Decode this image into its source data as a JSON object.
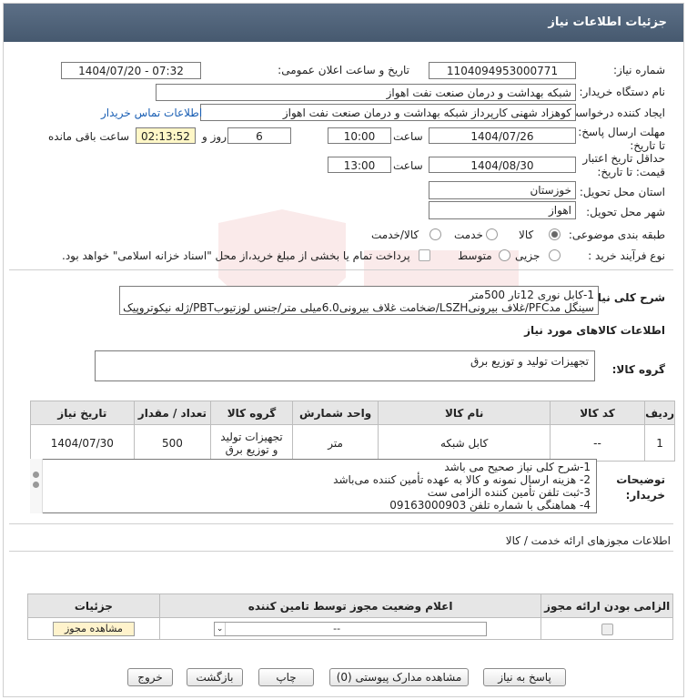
{
  "header": {
    "title": "جزئیات اطلاعات نیاز"
  },
  "form": {
    "need_number_label": "شماره نیاز:",
    "need_number": "1104094953000771",
    "announce_label": "تاریخ و ساعت اعلان عمومی:",
    "announce_value": "1404/07/20 - 07:32",
    "buyer_org_label": "نام دستگاه خریدار:",
    "buyer_org": "شبکه بهداشت و درمان صنعت نفت اهواز",
    "requester_label": "ایجاد کننده درخواست:",
    "requester": "کوهزاد شهنی کارپرداز شبکه بهداشت و درمان صنعت نفت اهواز",
    "contact_link": "اطلاعات تماس خریدار",
    "deadline_label": "مهلت ارسال پاسخ: تا تاریخ:",
    "deadline_date": "1404/07/26",
    "time_label": "ساعت",
    "deadline_time": "10:00",
    "days_value": "6",
    "days_label": "روز و",
    "remaining_value": "02:13:52",
    "remaining_label": "ساعت باقی مانده",
    "validity_label": "حداقل تاریخ اعتبار قیمت: تا تاریخ:",
    "validity_date": "1404/08/30",
    "validity_time": "13:00",
    "province_label": "استان محل تحویل:",
    "province": "خوزستان",
    "city_label": "شهر محل تحویل:",
    "city": "اهواز",
    "category_label": "طبقه بندی موضوعی:",
    "category_options": [
      "کالا",
      "خدمت",
      "کالا/خدمت"
    ],
    "process_label": "نوع فرآیند خرید :",
    "process_options": [
      "جزیی",
      "متوسط"
    ],
    "payment_note": "پرداخت تمام یا بخشی از مبلغ خرید،از محل \"اسناد خزانه اسلامی\" خواهد بود."
  },
  "summary": {
    "label": "شرح کلی نیاز:",
    "line1": "1-کابل نوری 12تار 500متر",
    "line2": "سینگل مدPFC/غلاف بیرونیLSZH/ضخامت غلاف بیرونی6.0میلی متر/جنس لوزتیوبPBT/ژله نیکوتروپیک"
  },
  "goods": {
    "section_title": "اطلاعات کالاهای مورد نیاز",
    "group_label": "گروه کالا:",
    "group_value": "تجهیزات تولید و توزیع برق",
    "columns": [
      "ردیف",
      "کد کالا",
      "نام کالا",
      "واحد شمارش",
      "گروه کالا",
      "تعداد / مقدار",
      "تاریخ نیاز"
    ],
    "row": {
      "index": "1",
      "code": "--",
      "name": "کابل شبکه",
      "unit": "متر",
      "group": "تجهیزات تولید و توزیع برق",
      "qty": "500",
      "date": "1404/07/30"
    }
  },
  "notes": {
    "label": "توضیحات خریدار:",
    "lines": [
      "1-شرح کلی نیاز صحیح می باشد",
      "2- هزینه ارسال نمونه و کالا به عهده تأمین کننده می‌باشد",
      "3-ثبت تلفن تأمین کننده الزامی ست",
      "4- هماهنگی با شماره تلفن 09163000903"
    ]
  },
  "permits": {
    "section_title": "اطلاعات مجوزهای ارائه خدمت / کالا",
    "columns": [
      "الزامی بودن ارائه مجوز",
      "اعلام وضعیت مجوز توسط تامین کننده",
      "جزئیات"
    ],
    "select_value": "--",
    "view_button": "مشاهده مجوز"
  },
  "actions": {
    "reply": "پاسخ به نیاز",
    "docs": "مشاهده مدارک پیوستی (0)",
    "print": "چاپ",
    "back": "بازگشت",
    "exit": "خروج"
  }
}
